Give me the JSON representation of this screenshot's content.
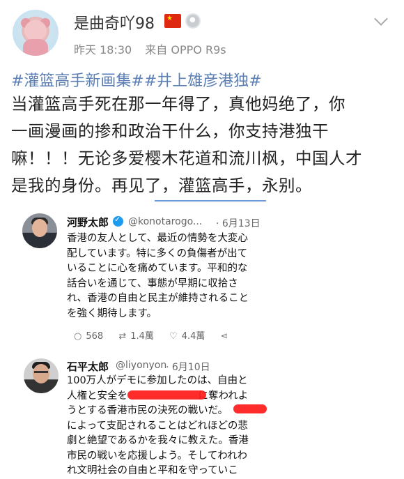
{
  "post": {
    "username": "是曲奇吖98",
    "time": "昨天 18:30",
    "source": "来自 OPPO R9s",
    "hashtags": "#灌篮高手新画集##井上雄彦港独#",
    "body_lines": [
      "当灌篮高手死在那一年得了，真他妈绝了，你",
      "一画漫画的掺和政治干什么，你支持港独干",
      "嘛！！！无论多爱樱木花道和流川枫，中国人才",
      "是我的身份。再见了，灌篮高手，永别。"
    ]
  },
  "tweet1": {
    "name": "河野太郎",
    "handle": "@konotarogo...",
    "date": "· 6月13日",
    "body": "香港の友人として、最近の情勢を大変心\n配しています。特に多くの負傷者が出て\nいることに心を痛めています。平和的な\n話合いを通じて、事態が早期に収拾さ\nれ、香港の自由と民主が維持されること\nを強く期待します。",
    "replies": "568",
    "retweets": "1.4萬",
    "likes": "4.4萬"
  },
  "tweet2": {
    "name": "石平太郎",
    "handle": "@liyonyon",
    "date": "· 6月10日",
    "body": "100万人がデモに参加したのは、自由と\n人権と安全を　　　　　　　に奪われよ\nうとする香港市民の決死の戦いだ。\nによって支配されることはどれほどの悲\n劇と絶望であるかを我々に教えた。香港\n市民の戦いを応援しよう。そしてわれわ\nれ文明社会の自由と平和を守っていこ"
  },
  "icons": {
    "flag": "china-flag-icon",
    "medal": "medal-icon",
    "chevron": "chevron-down-icon",
    "verified": "verified-icon",
    "reply": "reply-icon",
    "retweet": "retweet-icon",
    "like": "like-icon",
    "share": "share-icon"
  },
  "colors": {
    "hashtag": "#5b7fb5",
    "divider": "#6b9bd8",
    "redaction": "#ff1a1a",
    "verified": "#1d9bf0"
  }
}
